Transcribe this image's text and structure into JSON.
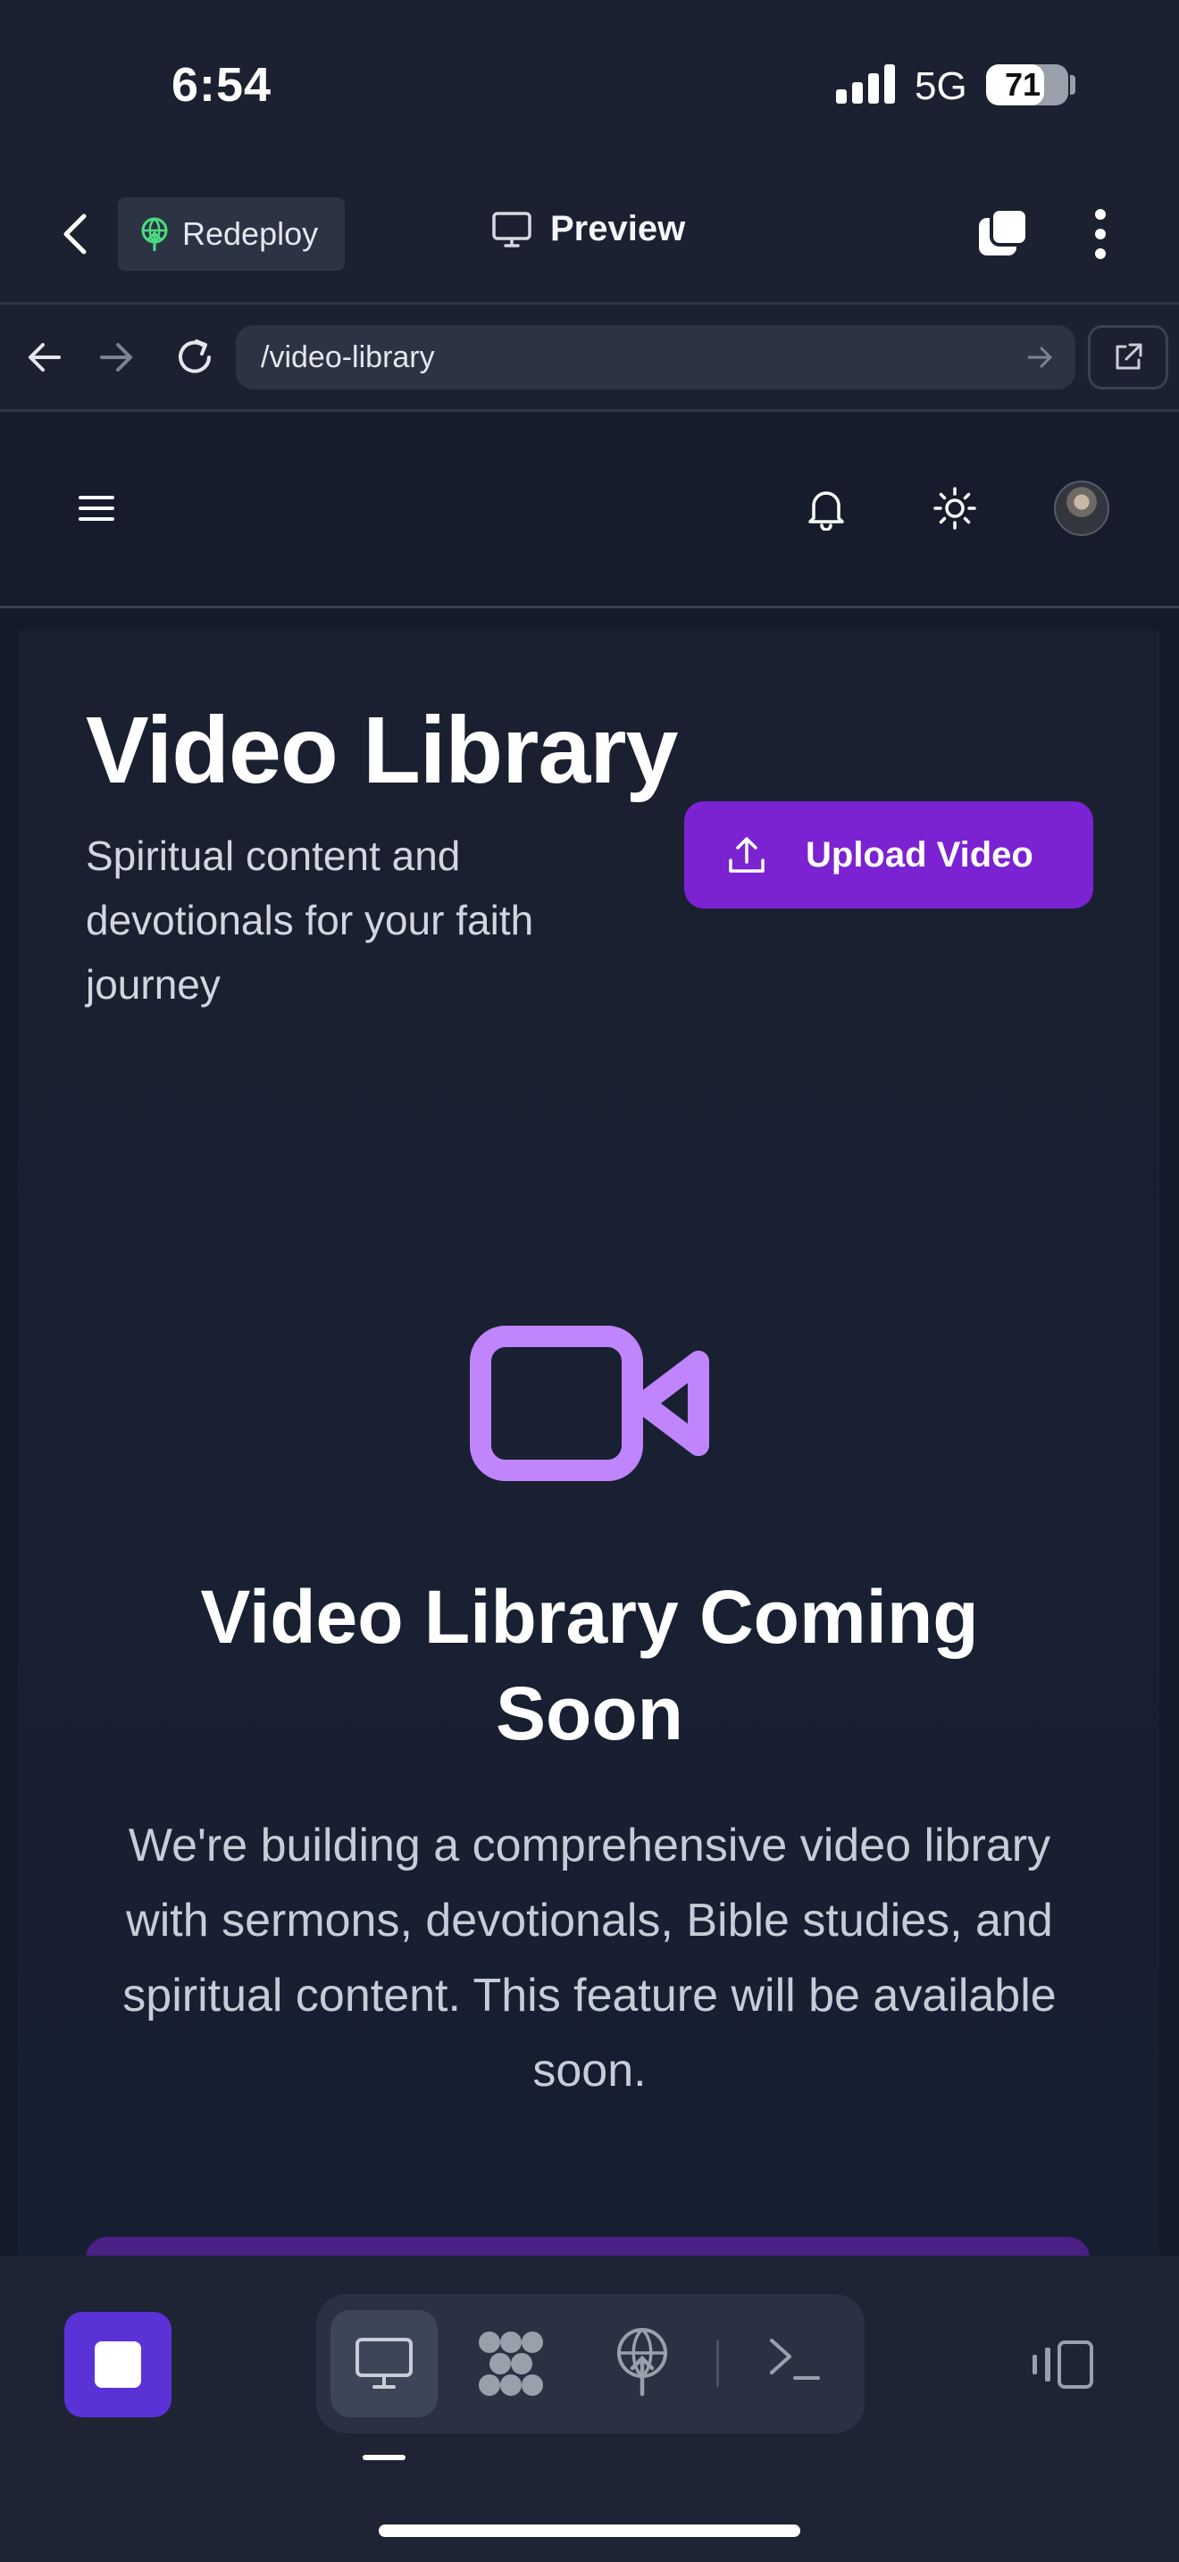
{
  "status_bar": {
    "time": "6:54",
    "network": "5G",
    "battery_level": "71",
    "battery_fraction": 0.71,
    "icons": [
      "signal-bars-icon",
      "battery-icon"
    ]
  },
  "app_bar": {
    "back_icon": "chevron-left-icon",
    "redeploy_label": "Redeploy",
    "redeploy_icon": "deploy-globe-icon",
    "preview_label": "Preview",
    "preview_icon": "monitor-icon",
    "tabs_icon": "tabs-icon",
    "more_icon": "more-vertical-icon"
  },
  "browser": {
    "url": "/video-library",
    "icons": [
      "arrow-left-icon",
      "arrow-right-icon",
      "reload-icon",
      "arrow-go-icon",
      "external-link-icon"
    ]
  },
  "site_header": {
    "icons": [
      "menu-icon",
      "bell-icon",
      "sun-icon",
      "avatar"
    ]
  },
  "page": {
    "title": "Video Library",
    "subtitle": "Spiritual content and devotionals for your faith journey",
    "upload_button": "Upload Video",
    "upload_icon": "upload-icon",
    "placeholder_icon": "video-camera-icon",
    "coming_soon_title": "Video Library Coming Soon",
    "coming_soon_description": "We're building a comprehensive video library with sermons, devotionals, Bible studies, and spiritual content. This feature will be available soon."
  },
  "bottom_toolbar": {
    "stop_icon": "stop-icon",
    "tools": [
      "desktop-icon",
      "apps-icon",
      "deploy-icon",
      "shell-icon"
    ],
    "active_tool": "desktop-icon",
    "layout_icon": "layout-toggle-icon"
  },
  "colors": {
    "background": "#1b2130",
    "accent_purple": "#7b22d2",
    "icon_purple": "#c084fc",
    "stop_button": "#5b32d6",
    "surface": "#2c3444"
  }
}
